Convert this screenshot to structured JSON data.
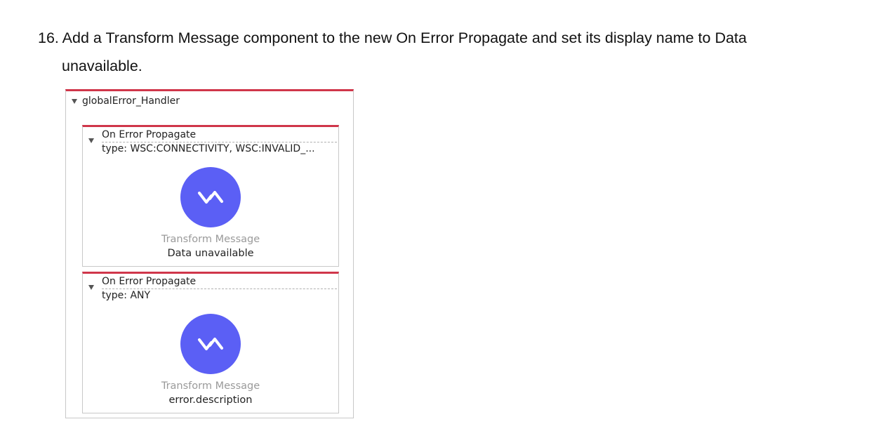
{
  "instruction": {
    "line1": "16. Add a Transform Message component to the new On Error Propagate and set its display name to Data",
    "line2": "unavailable."
  },
  "handler": {
    "name": "globalError_Handler",
    "scopes": [
      {
        "title": "On Error Propagate",
        "type": "type: WSC:CONNECTIVITY, WSC:INVALID_...",
        "component_type": "Transform Message",
        "component_name": "Data unavailable",
        "icon": "transform-message-icon"
      },
      {
        "title": "On Error Propagate",
        "type": "type: ANY",
        "component_type": "Transform Message",
        "component_name": "error.description",
        "icon": "transform-message-icon"
      }
    ]
  },
  "colors": {
    "scope_accent": "#d0364a",
    "component_icon": "#5b5ff5"
  }
}
